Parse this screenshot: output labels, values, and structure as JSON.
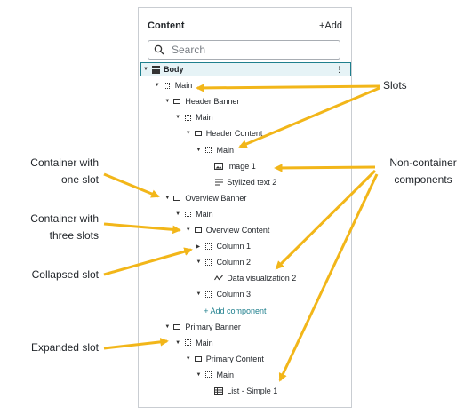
{
  "panel": {
    "title": "Content",
    "add_label": "+Add",
    "search_placeholder": "Search"
  },
  "tree": [
    {
      "label": "Body",
      "icon": "layout-icon",
      "kind": "body",
      "caret": "expanded",
      "selected": true,
      "menu": "⋮"
    },
    {
      "label": "Main",
      "icon": "slot-icon",
      "kind": "slot",
      "caret": "expanded"
    },
    {
      "label": "Header Banner",
      "icon": "container-icon",
      "kind": "container",
      "caret": "expanded"
    },
    {
      "label": "Main",
      "icon": "slot-icon",
      "kind": "slot",
      "caret": "expanded"
    },
    {
      "label": "Header Content",
      "icon": "container-icon",
      "kind": "container",
      "caret": "expanded"
    },
    {
      "label": "Main",
      "icon": "slot-icon",
      "kind": "slot",
      "caret": "expanded"
    },
    {
      "label": "Image 1",
      "icon": "image-icon",
      "kind": "component"
    },
    {
      "label": "Stylized text 2",
      "icon": "text-icon",
      "kind": "component"
    },
    {
      "label": "Overview Banner",
      "icon": "container-icon",
      "kind": "container",
      "caret": "expanded"
    },
    {
      "label": "Main",
      "icon": "slot-icon",
      "kind": "slot",
      "caret": "expanded"
    },
    {
      "label": "Overview Content",
      "icon": "container-icon",
      "kind": "container",
      "caret": "expanded"
    },
    {
      "label": "Column 1",
      "icon": "slot-icon",
      "kind": "slot",
      "caret": "collapsed"
    },
    {
      "label": "Column 2",
      "icon": "slot-icon",
      "kind": "slot",
      "caret": "expanded"
    },
    {
      "label": "Data visualization 2",
      "icon": "chart-icon",
      "kind": "component"
    },
    {
      "label": "Column 3",
      "icon": "slot-icon",
      "kind": "slot",
      "caret": "expanded"
    },
    {
      "label": "+ Add component",
      "kind": "add"
    },
    {
      "label": "Primary Banner",
      "icon": "container-icon",
      "kind": "container",
      "caret": "expanded"
    },
    {
      "label": "Main",
      "icon": "slot-icon",
      "kind": "slot",
      "caret": "expanded"
    },
    {
      "label": "Primary Content",
      "icon": "container-icon",
      "kind": "container",
      "caret": "expanded"
    },
    {
      "label": "Main",
      "icon": "slot-icon",
      "kind": "slot",
      "caret": "expanded"
    },
    {
      "label": "List - Simple 1",
      "icon": "table-icon",
      "kind": "component"
    }
  ],
  "annotations": {
    "slots": "Slots",
    "non_container": [
      "Non-container",
      "components"
    ],
    "one_slot": [
      "Container with",
      "one slot"
    ],
    "three_slots": [
      "Container with",
      "three slots"
    ],
    "collapsed": "Collapsed slot",
    "expanded": "Expanded slot"
  },
  "colors": {
    "arrow": "#f2b619",
    "accent": "#1e7f8d"
  }
}
